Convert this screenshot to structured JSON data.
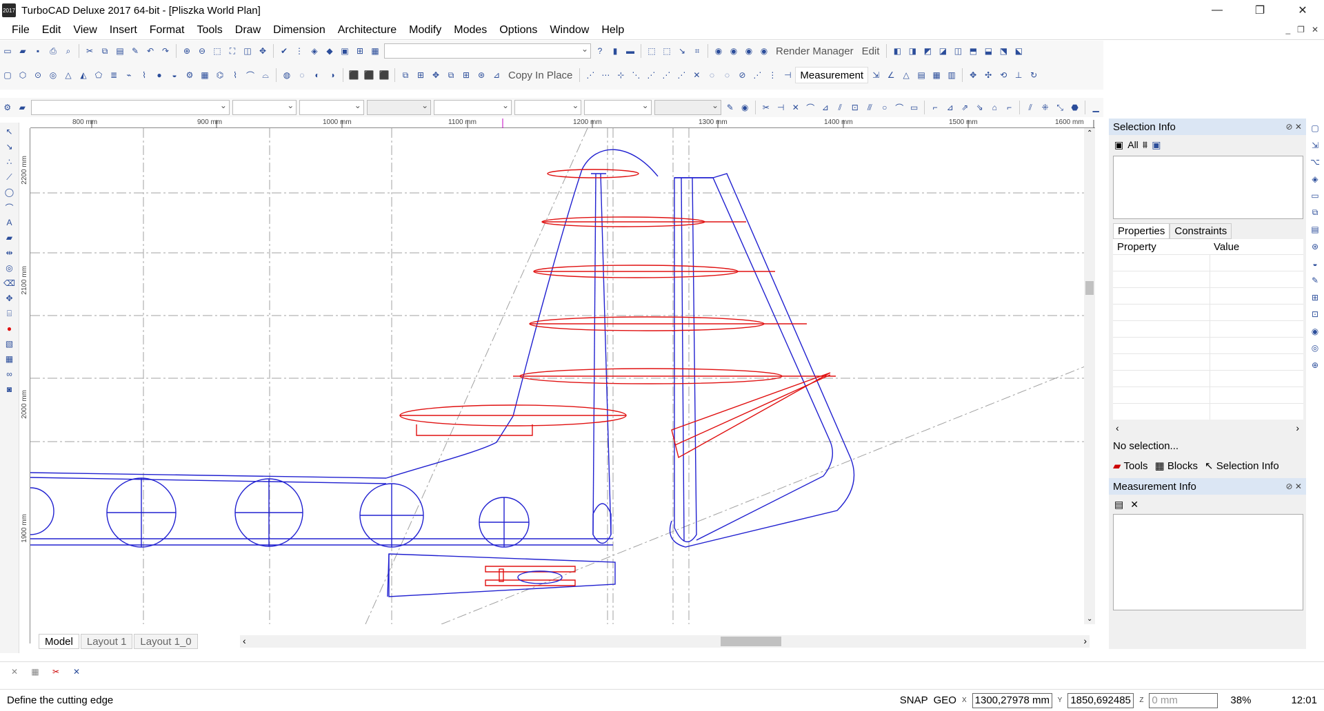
{
  "window": {
    "title": "TurboCAD Deluxe 2017 64-bit - [Pliszka World Plan]",
    "app_icon_text": "2017",
    "controls": [
      "—",
      "❐",
      "✕"
    ]
  },
  "menu": [
    "File",
    "Edit",
    "View",
    "Insert",
    "Format",
    "Tools",
    "Draw",
    "Dimension",
    "Architecture",
    "Modify",
    "Modes",
    "Options",
    "Window",
    "Help"
  ],
  "toolbar": {
    "render_manager_label": "Render Manager",
    "edit_label": "Edit",
    "copy_in_place_label": "Copy In Place",
    "measurement_label": "Measurement"
  },
  "ruler": {
    "top_labels": [
      "800 mm",
      "900 mm",
      "1000 mm",
      "1100 mm",
      "1200 mm",
      "1300 mm",
      "1400 mm",
      "1500 mm",
      "1600 mm"
    ],
    "left_labels": [
      "2200 mm",
      "2100 mm",
      "2000 mm",
      "1900 mm"
    ]
  },
  "tabs": [
    "Model",
    "Layout 1",
    "Layout 1_0"
  ],
  "selection_info": {
    "title": "Selection Info",
    "all_label": "All",
    "properties_tab": "Properties",
    "constraints_tab": "Constraints",
    "property_col": "Property",
    "value_col": "Value",
    "no_selection": "No selection...",
    "bottom_tabs": [
      "Tools",
      "Blocks",
      "Selection Info"
    ]
  },
  "measurement_info": {
    "title": "Measurement Info"
  },
  "status": {
    "message": "Define the cutting edge",
    "snap": "SNAP",
    "geo": "GEO",
    "x_label": "X",
    "x_value": "1300,27978 mm",
    "y_label": "Y",
    "y_value": "1850,692485",
    "z_label": "Z",
    "z_placeholder": "0 mm",
    "zoom": "38%",
    "time": "12:01"
  },
  "colors": {
    "blue_lines": "#2020d0",
    "red_lines": "#e01010",
    "guide_lines": "#a0a0a0"
  }
}
